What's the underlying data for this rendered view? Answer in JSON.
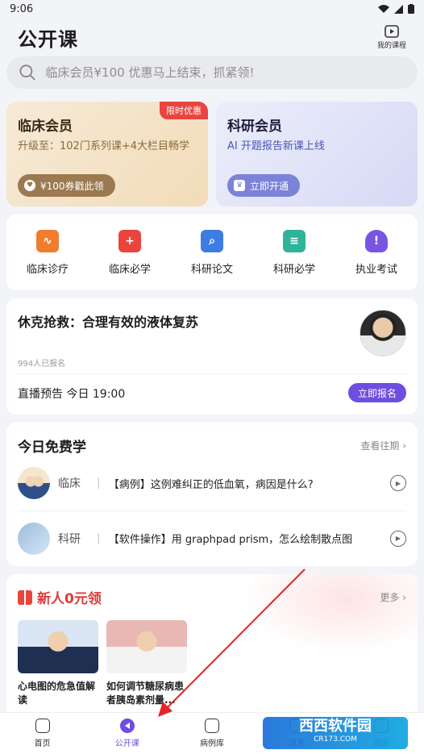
{
  "status": {
    "time": "9:06"
  },
  "header": {
    "title": "公开课",
    "my_courses": "我的课程"
  },
  "search": {
    "placeholder": "临床会员¥100 优惠马上结束，抓紧领!"
  },
  "members": {
    "clinical": {
      "title": "临床会员",
      "subtitle": "升级至：102门系列课+4大栏目畅学",
      "badge": "限时优惠",
      "button": "¥100券戳此领"
    },
    "research": {
      "title": "科研会员",
      "subtitle": "AI 开题报告新课上线",
      "button": "立即开通"
    }
  },
  "categories": [
    {
      "label": "临床诊疗",
      "icon": "pulse-icon",
      "color": "#f07c2e"
    },
    {
      "label": "临床必学",
      "icon": "plus-bookmark-icon",
      "color": "#e9443e"
    },
    {
      "label": "科研论文",
      "icon": "search-doc-icon",
      "color": "#3d7de3"
    },
    {
      "label": "科研必学",
      "icon": "document-icon",
      "color": "#2fb39a"
    },
    {
      "label": "执业考试",
      "icon": "badge-icon",
      "color": "#7a55e4"
    }
  ],
  "live": {
    "title": "休克抢救：合理有效的液体复苏",
    "count": "994人已报名",
    "time": "直播预告 今日 19:00",
    "button": "立即报名"
  },
  "free": {
    "title": "今日免费学",
    "view_past": "查看往期 ›",
    "items": [
      {
        "category": "临床",
        "text": "【病例】这例难纠正的低血氧，病因是什么?"
      },
      {
        "category": "科研",
        "text": "【软件操作】用 graphpad prism，怎么绘制散点图"
      }
    ]
  },
  "newbie": {
    "title": "新人0元领",
    "more": "更多 ›",
    "courses": [
      {
        "title": "心电图的危急值解读"
      },
      {
        "title": "如何调节糖尿病患者胰岛素剂量..."
      }
    ]
  },
  "tabbar": [
    {
      "label": "首页"
    },
    {
      "label": "公开课"
    },
    {
      "label": "病例库"
    },
    {
      "label": "消息"
    },
    {
      "label": "我的"
    }
  ],
  "watermark": {
    "text": "西西软件园",
    "sub": "CR173.COM"
  },
  "accent": "#6e4ee0"
}
